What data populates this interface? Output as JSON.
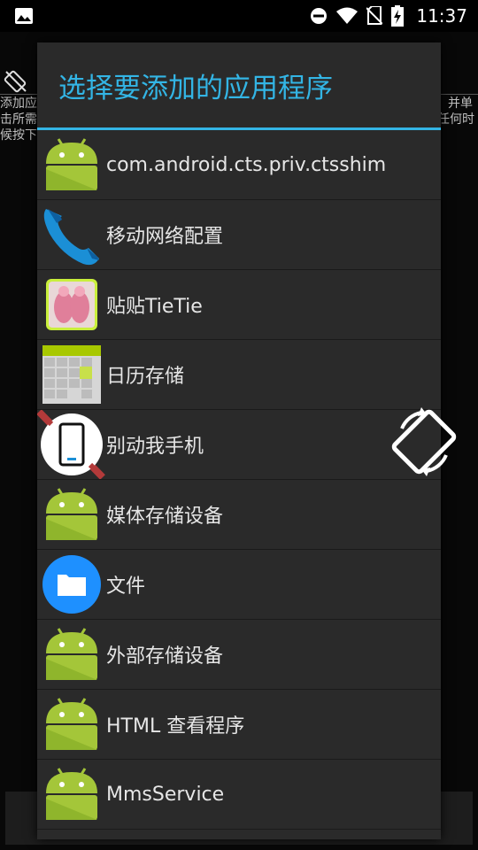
{
  "status_bar": {
    "time": "11:37",
    "icons": [
      "image-icon",
      "do-not-disturb-icon",
      "wifi-icon",
      "no-sim-icon",
      "battery-charging-icon"
    ]
  },
  "background_app": {
    "left_text": "添加应\n击所需\n候按下",
    "right_text": "并单\n任何时"
  },
  "dialog": {
    "title": "选择要添加的应用程序",
    "accent_color": "#33b5e5",
    "apps": [
      {
        "label": "com.android.cts.priv.ctsshim",
        "icon": "android-icon"
      },
      {
        "label": "移动网络配置",
        "icon": "phone-icon"
      },
      {
        "label": "贴贴TieTie",
        "icon": "tietie-app-icon"
      },
      {
        "label": "日历存储",
        "icon": "calendar-storage-icon"
      },
      {
        "label": "别动我手机",
        "icon": "no-phone-icon"
      },
      {
        "label": "媒体存储设备",
        "icon": "android-icon"
      },
      {
        "label": "文件",
        "icon": "folder-icon"
      },
      {
        "label": "外部存储设备",
        "icon": "android-icon"
      },
      {
        "label": "HTML 查看程序",
        "icon": "android-icon"
      },
      {
        "label": "MmsService",
        "icon": "android-icon"
      }
    ]
  }
}
